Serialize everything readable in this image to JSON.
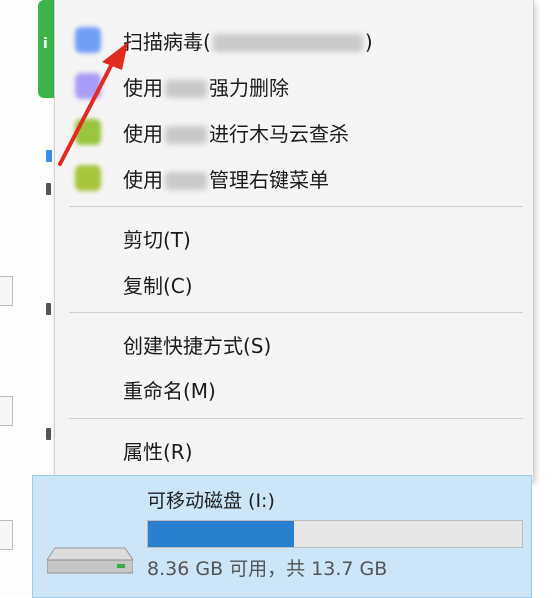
{
  "menu": {
    "items": [
      {
        "prefix": "扫描病毒(",
        "suffix": ")",
        "icon_color": "#6f9ef5",
        "icon": "antivirus-scan-icon"
      },
      {
        "prefix": "使用",
        "suffix": "强力删除",
        "icon_color": "#a99cf6",
        "icon": "force-delete-icon"
      },
      {
        "prefix": "使用",
        "suffix": "进行木马云查杀",
        "icon_color": "#9ac63e",
        "icon": "trojan-cloud-scan-icon"
      },
      {
        "prefix": "使用",
        "suffix": "管理右键菜单",
        "icon_color": "#a7c43a",
        "icon": "context-menu-manager-icon"
      }
    ],
    "cut": "剪切(T)",
    "copy": "复制(C)",
    "shortcut": "创建快捷方式(S)",
    "rename": "重命名(M)",
    "properties": "属性(R)"
  },
  "drive": {
    "name": "可移动磁盘 (I:)",
    "space_text": "8.36 GB 可用，共 13.7 GB",
    "used_fraction": 0.39,
    "bar_color": "#2a7fcf"
  },
  "colors": {
    "arrow": "#e02b20",
    "selection": "#cce6f8"
  }
}
